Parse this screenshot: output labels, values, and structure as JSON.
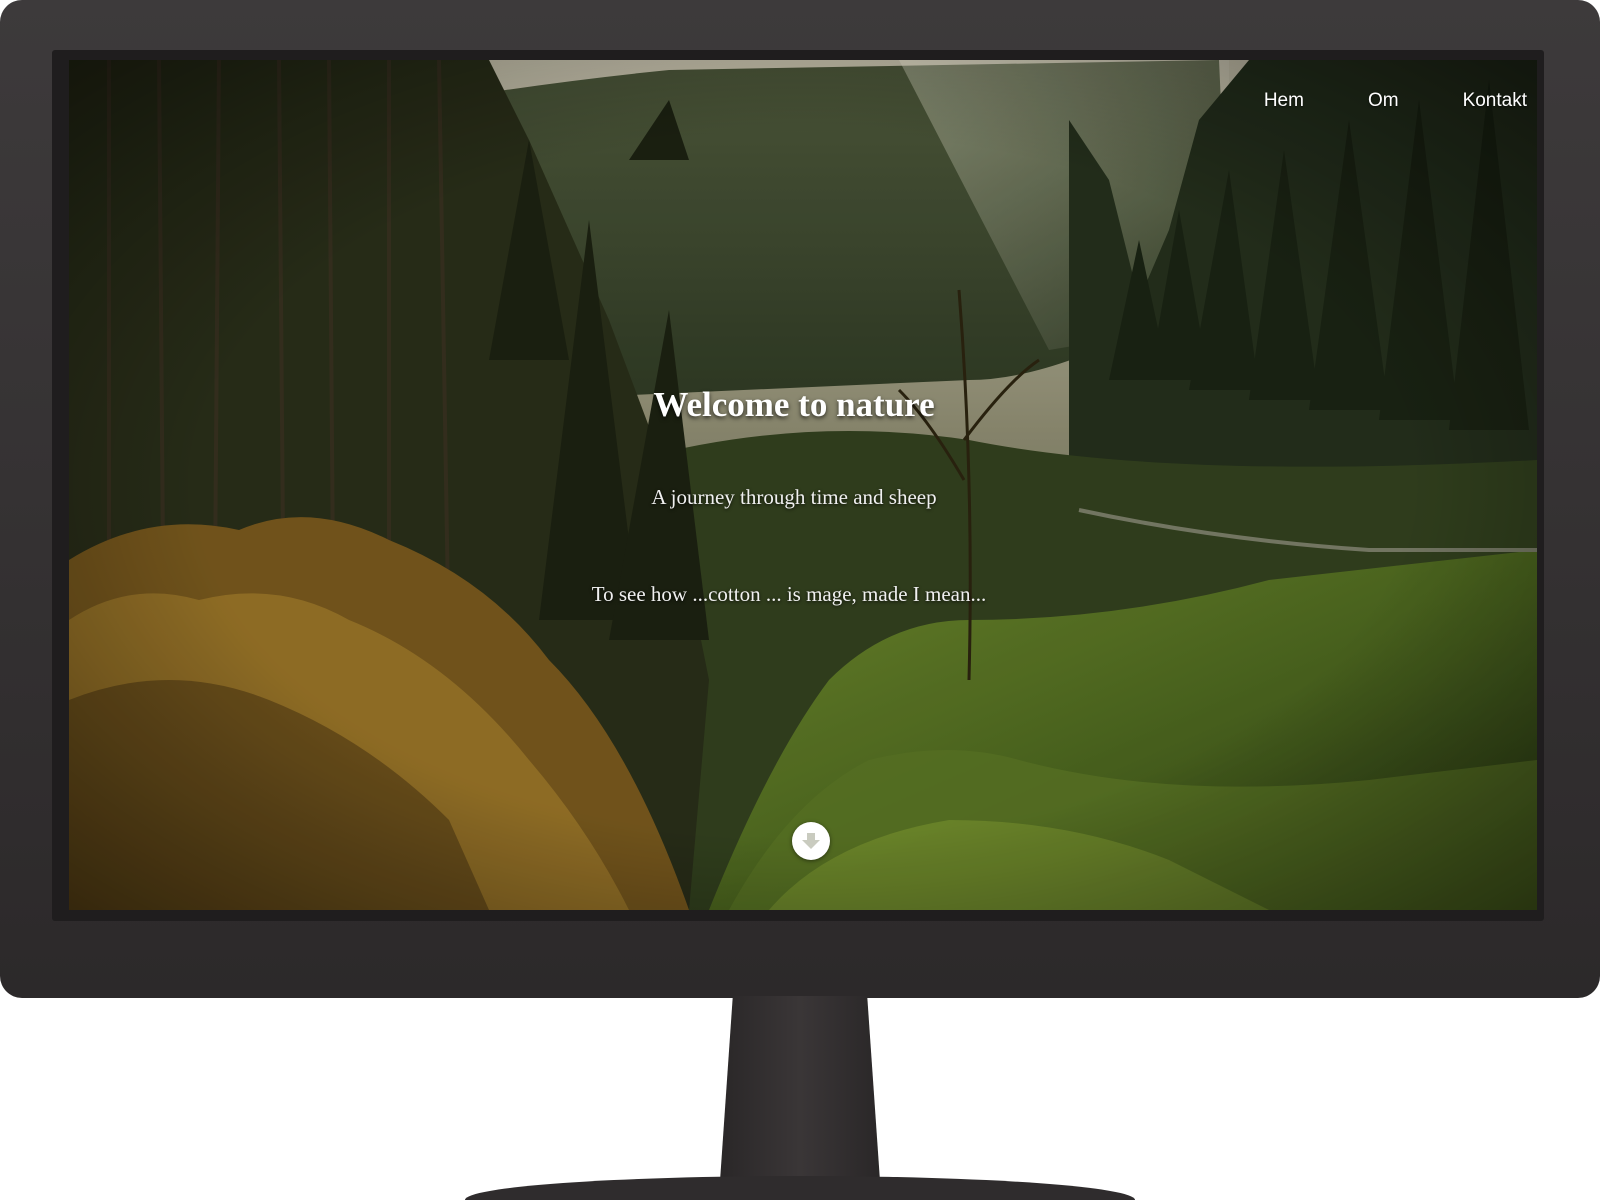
{
  "nav": {
    "items": [
      {
        "label": "Hem"
      },
      {
        "label": "Om"
      },
      {
        "label": "Kontakt"
      }
    ]
  },
  "hero": {
    "title": "Welcome to nature",
    "subtitle": "A journey through time and sheep",
    "text": "To see how ...cotton ... is mage, made I mean..."
  },
  "icons": {
    "scroll": "arrow-down-circle-icon"
  },
  "colors": {
    "monitor_frame": "#363334",
    "text": "#ffffff"
  }
}
